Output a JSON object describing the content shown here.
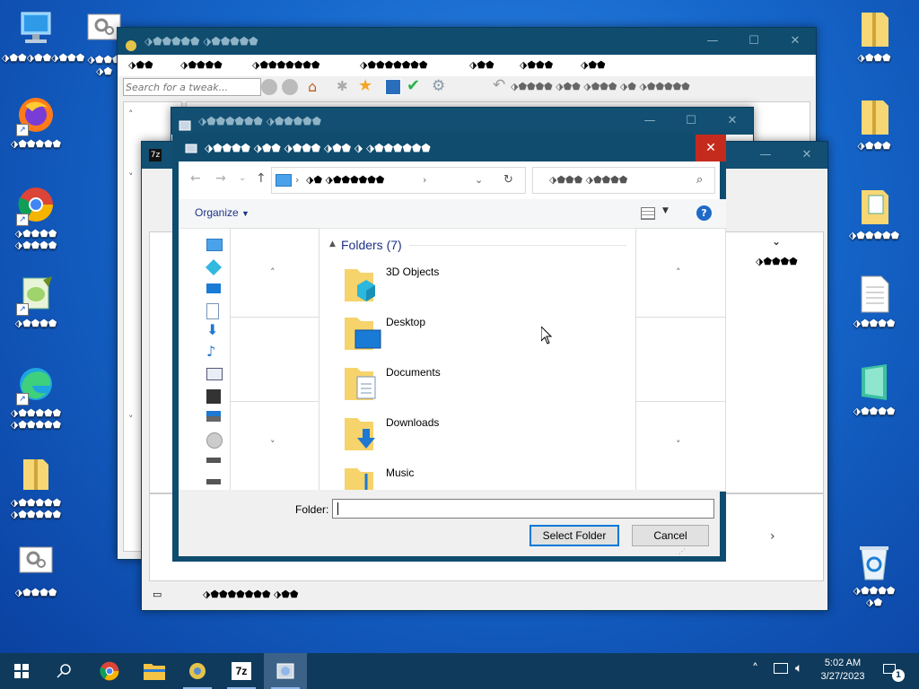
{
  "desktop": {
    "left_icons": [
      {
        "name": "this-pc-icon",
        "label": "⬗⬟⬟⬗⬟⬟⬗⬟⬟⬟"
      },
      {
        "name": "firefox-icon",
        "label": "⬗⬟⬟⬟⬟⬟"
      },
      {
        "name": "chrome-icon",
        "label": "⬗⬟⬟⬟⬟\n⬗⬟⬟⬟⬟"
      },
      {
        "name": "notepadpp-icon",
        "label": "⬗⬟⬟⬟⬟"
      },
      {
        "name": "edge-icon",
        "label": "⬗⬟⬟⬟⬟⬟\n⬗⬟⬟⬟⬟⬟"
      },
      {
        "name": "folder-icon",
        "label": "⬗⬟⬟⬟⬟⬟\n⬗⬟⬟⬟⬟⬟"
      },
      {
        "name": "settings-file-icon",
        "label": "⬗⬟⬟⬟⬟"
      }
    ],
    "right_icons": [
      {
        "name": "zip-folder-icon",
        "label": "⬗⬟⬟⬟"
      },
      {
        "name": "zip-folder-icon",
        "label": "⬗⬟⬟⬟"
      },
      {
        "name": "document-folder-icon",
        "label": "⬗⬟⬟⬟⬟⬟"
      },
      {
        "name": "text-file-icon",
        "label": "⬗⬟⬟⬟⬟"
      },
      {
        "name": "app-file-icon",
        "label": "⬗⬟⬟⬟⬟"
      },
      {
        "name": "recycle-bin-icon",
        "label": "⬗⬟⬟⬟⬟\n⬗⬟"
      }
    ],
    "misc_icon_label": "⬗⬟⬟⬟\n⬗⬟"
  },
  "tweak_window": {
    "title": "⬗⬟⬟⬟⬟⬟ ⬗⬟⬟⬟⬟⬟",
    "menu": [
      "⬗⬟⬟",
      "⬗⬟⬟⬟⬟",
      "⬗⬟⬟⬟⬟⬟⬟⬟",
      "⬗⬟⬟⬟⬟⬟⬟⬟",
      "⬗⬟⬟",
      "⬗⬟⬟⬟",
      "⬗⬟⬟"
    ],
    "search_placeholder": "Search for a tweak...",
    "toolbar_text": "⬗⬟⬟⬟⬟ ⬗⬟⬟ ⬗⬟⬟⬟ ⬗⬟ ⬗⬟⬟⬟⬟⬟"
  },
  "mid_window": {
    "title": "⬗⬟⬟⬟⬟⬟⬟ ⬗⬟⬟⬟⬟⬟"
  },
  "sevenzip_window": {
    "status_text": "⬗⬟⬟⬟⬟⬟⬟⬟ ⬗⬟⬟",
    "right_col_text": "⬗⬟⬟⬟⬟"
  },
  "dialog": {
    "title": "⬗⬟⬟⬟⬟ ⬗⬟⬟ ⬗⬟⬟⬟ ⬗⬟⬟ ⬗ ⬗⬟⬟⬟⬟⬟⬟",
    "address_path": "⬗⬟ ⬗⬟⬟⬟⬟⬟⬟",
    "search_placeholder": "⬗⬟⬟⬟ ⬗⬟⬟⬟⬟",
    "organize_label": "Organize",
    "group_header": "Folders (7)",
    "folders": [
      {
        "name": "3D Objects",
        "icon": "3d-objects-folder-icon"
      },
      {
        "name": "Desktop",
        "icon": "desktop-folder-icon"
      },
      {
        "name": "Documents",
        "icon": "documents-folder-icon"
      },
      {
        "name": "Downloads",
        "icon": "downloads-folder-icon"
      },
      {
        "name": "Music",
        "icon": "music-folder-icon"
      }
    ],
    "folder_label": "Folder:",
    "folder_value": "",
    "select_button": "Select Folder",
    "cancel_button": "Cancel"
  },
  "taskbar": {
    "time": "5:02 AM",
    "date": "3/27/2023",
    "notification_count": "1"
  }
}
